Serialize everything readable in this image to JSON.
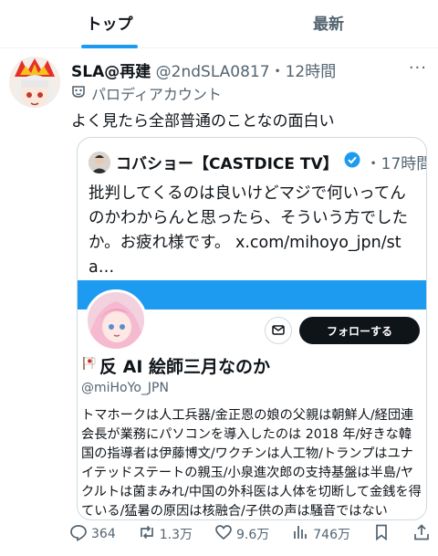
{
  "tabs": [
    {
      "label": "トップ",
      "active": true
    },
    {
      "label": "最新",
      "active": false
    }
  ],
  "post": {
    "display_name": "SLA@再建",
    "handle_time": "@2ndSLA0817・12時間",
    "parody_label": "パロディアカウント",
    "text": "よく見たら全部普通のことなの面白い"
  },
  "quote": {
    "display_name": "コバショー【CASTDICE TV】",
    "time": "・17時間",
    "text": "批判してくるのは良いけどマジで何いってんのかわからんと思ったら、そういう方でしたか。お疲れ様です。 x.com/mihoyo_jpn/sta…",
    "card": {
      "follow_label": "フォローする",
      "name": "反 AI 絵師三月なのか",
      "handle": "@miHoYo_JPN",
      "bio": "トマホークは人工兵器/金正恩の娘の父親は朝鮮人/経団連会長が業務にパソコンを導入したのは 2018 年/好きな韓国の指導者は伊藤博文/ワクチンは人工物/トランプはユナイテッドステートの親玉/小泉進次郎の支持基盤は半島/ヤクルトは菌まみれ/中国の外科医は人体を切断して金銭を得ている/猛暑の原因は核融合/子供の声は騒音ではない"
    }
  },
  "actions": {
    "replies": "364",
    "reposts": "1.3万",
    "likes": "9.6万",
    "views": "746万"
  },
  "colors": {
    "accent": "#1d9bf0",
    "verified": "#1d9bf0",
    "text_primary": "#0f1419",
    "text_secondary": "#536471",
    "follow_button": "#0f1419"
  },
  "icons": [
    "more-icon",
    "parody-mask-icon",
    "verified-badge-icon",
    "mail-icon",
    "flag-icon",
    "reply-icon",
    "repost-icon",
    "like-icon",
    "views-icon",
    "bookmark-icon",
    "share-icon"
  ]
}
